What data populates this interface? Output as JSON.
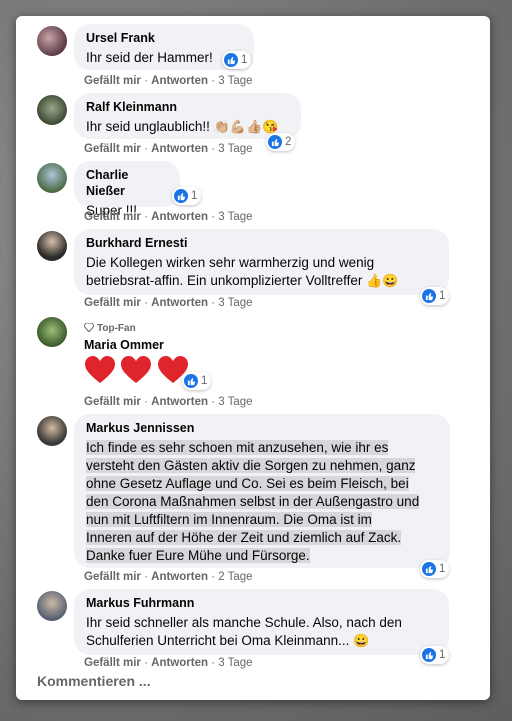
{
  "actions": {
    "like": "Gefällt mir",
    "reply": "Antworten",
    "sep": "·"
  },
  "comments": [
    {
      "author": "Ursel Frank",
      "text": "Ihr seid der Hammer!",
      "time": "3 Tage",
      "likes": "1"
    },
    {
      "author": "Ralf Kleinmann",
      "text": "Ihr seid unglaublich!!",
      "time": "3 Tage",
      "likes": "2"
    },
    {
      "author": "Charlie Nießer",
      "text": "Super !!!",
      "time": "3 Tage",
      "likes": "1"
    },
    {
      "author": "Burkhard Ernesti",
      "text_lines": [
        "Die Kollegen wirken sehr warmherzig und wenig",
        "betriebsrat-affin. Ein unkomplizierter Volltreffer"
      ],
      "time": "3 Tage",
      "likes": "1"
    },
    {
      "badge": "Top-Fan",
      "author": "Maria Ommer",
      "time": "3 Tage",
      "likes": "1"
    },
    {
      "author": "Markus Jennissen",
      "text_lines": [
        "Ich finde es sehr schoen mit anzusehen, wie ihr es",
        "versteht den Gästen aktiv die Sorgen zu nehmen, ganz",
        "ohne Gesetz Auflage und Co. Sei es beim Fleisch, bei",
        "den Corona Maßnahmen selbst in der Außengastro und",
        "nun mit Luftfiltern im Innenraum. Die Oma ist im",
        "Inneren auf der Höhe der Zeit und ziemlich auf Zack.",
        "Danke fuer Eure Mühe und Fürsorge."
      ],
      "time": "2 Tage",
      "likes": "1"
    },
    {
      "author": "Markus Fuhrmann",
      "text_lines": [
        "Ihr seid schneller als manche Schule. Also, nach den",
        "Schulferien Unterricht bei Oma Kleinmann..."
      ],
      "time": "3 Tage",
      "likes": "1"
    }
  ],
  "footer": {
    "write_comment": "Kommentieren ..."
  },
  "icons": {
    "like": "like-icon",
    "badge": "diamond-icon"
  },
  "colors": {
    "like_blue": "#1b74e4",
    "bubble": "#f0f2f5",
    "meta": "#65676b"
  }
}
